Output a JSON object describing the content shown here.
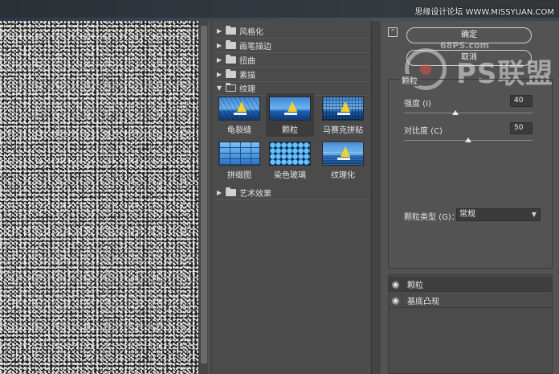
{
  "watermark_top": "思缘设计论坛 WWW.MISSYUAN.COM",
  "watermark_side": "68PS.com",
  "logo_text": "PS联盟",
  "logo_digit": "6",
  "gallery": {
    "categories": [
      {
        "label": "风格化",
        "open": false
      },
      {
        "label": "画笔描边",
        "open": false
      },
      {
        "label": "扭曲",
        "open": false
      },
      {
        "label": "素描",
        "open": false
      },
      {
        "label": "纹理",
        "open": true
      },
      {
        "label": "艺术效果",
        "open": false
      }
    ],
    "texture_filters": [
      {
        "label": "龟裂缝",
        "icon": "cracks-thumbnail"
      },
      {
        "label": "颗粒",
        "icon": "grain-thumbnail",
        "selected": true
      },
      {
        "label": "马赛克拼贴",
        "icon": "mosaic-thumbnail"
      },
      {
        "label": "拼缀图",
        "icon": "patchwork-thumbnail"
      },
      {
        "label": "染色玻璃",
        "icon": "stained-glass-thumbnail"
      },
      {
        "label": "纹理化",
        "icon": "texturizer-thumbnail"
      }
    ]
  },
  "buttons": {
    "ok": "确定",
    "cancel": "取消",
    "collapse_icon": "collapse-icon"
  },
  "options": {
    "title": "颗粒",
    "intensity_label": "强度 (I)",
    "intensity_value": "40",
    "intensity_level": 40,
    "contrast_label": "对比度 (C)",
    "contrast_value": "50",
    "contrast_level": 50,
    "grain_type_label": "颗粒类型 (G)：",
    "grain_type_value": "常规"
  },
  "layers": [
    {
      "name": "颗粒",
      "active": true
    },
    {
      "name": "基底凸现",
      "active": false
    }
  ]
}
